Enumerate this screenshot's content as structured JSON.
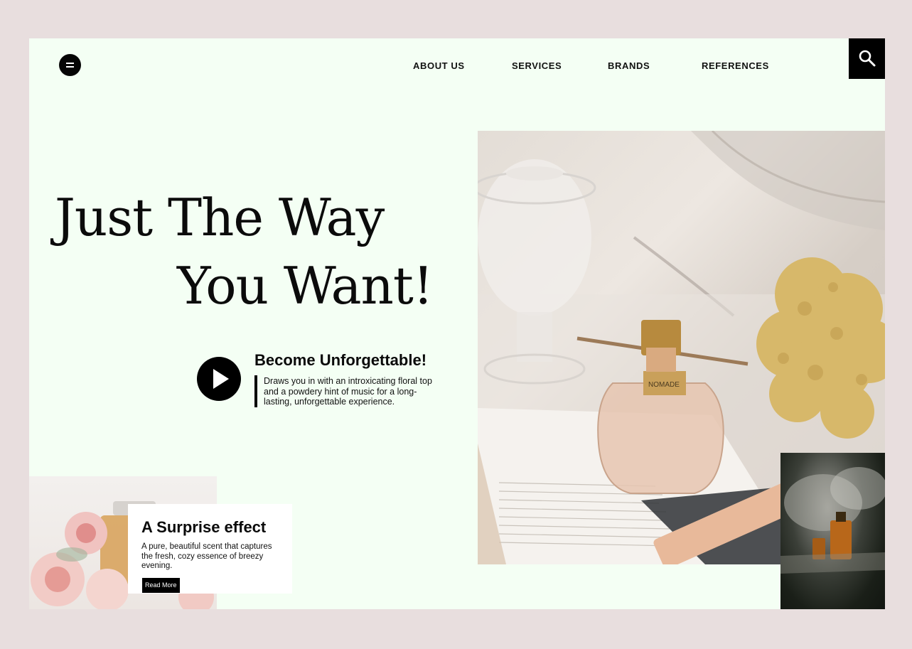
{
  "nav": {
    "items": [
      {
        "label": "ABOUT US"
      },
      {
        "label": "SERVICES"
      },
      {
        "label": "BRANDS"
      },
      {
        "label": "REFERENCES"
      }
    ]
  },
  "hero": {
    "line1": "Just The Way",
    "line2": "You Want!"
  },
  "feature": {
    "title": "Become Unforgettable!",
    "description": "Draws you in with an introxicating floral top and a powdery hint of music for a long-lasting, unforgettable experience."
  },
  "product": {
    "label": "NOMADE"
  },
  "surprise": {
    "title": "A Surprise effect",
    "description": "A pure, beautiful scent that captures the fresh, cozy essence of breezy evening.",
    "button_label": "Read More"
  },
  "icons": {
    "menu": "menu-icon",
    "search": "search-icon",
    "play": "play-icon"
  },
  "colors": {
    "page_bg": "#e8dede",
    "card_bg": "#f4fff4",
    "accent": "#000000"
  }
}
